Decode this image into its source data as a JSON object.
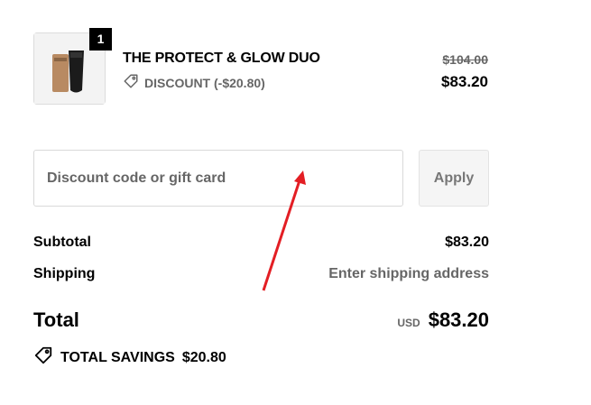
{
  "cart": {
    "item": {
      "quantity": "1",
      "name": "THE PROTECT & GLOW DUO",
      "discount_label": "DISCOUNT (-$20.80)",
      "original_price": "$104.00",
      "final_price": "$83.20"
    }
  },
  "discount": {
    "placeholder": "Discount code or gift card",
    "apply_label": "Apply"
  },
  "summary": {
    "subtotal_label": "Subtotal",
    "subtotal_value": "$83.20",
    "shipping_label": "Shipping",
    "shipping_value": "Enter shipping address",
    "total_label": "Total",
    "currency": "USD",
    "total_value": "$83.20",
    "savings_label": "TOTAL SAVINGS",
    "savings_value": "$20.80"
  },
  "icons": {
    "tag": "tag-icon",
    "annotation": "red-arrow-annotation"
  },
  "colors": {
    "annotation_red": "#e31e24",
    "muted_text": "#666666"
  }
}
